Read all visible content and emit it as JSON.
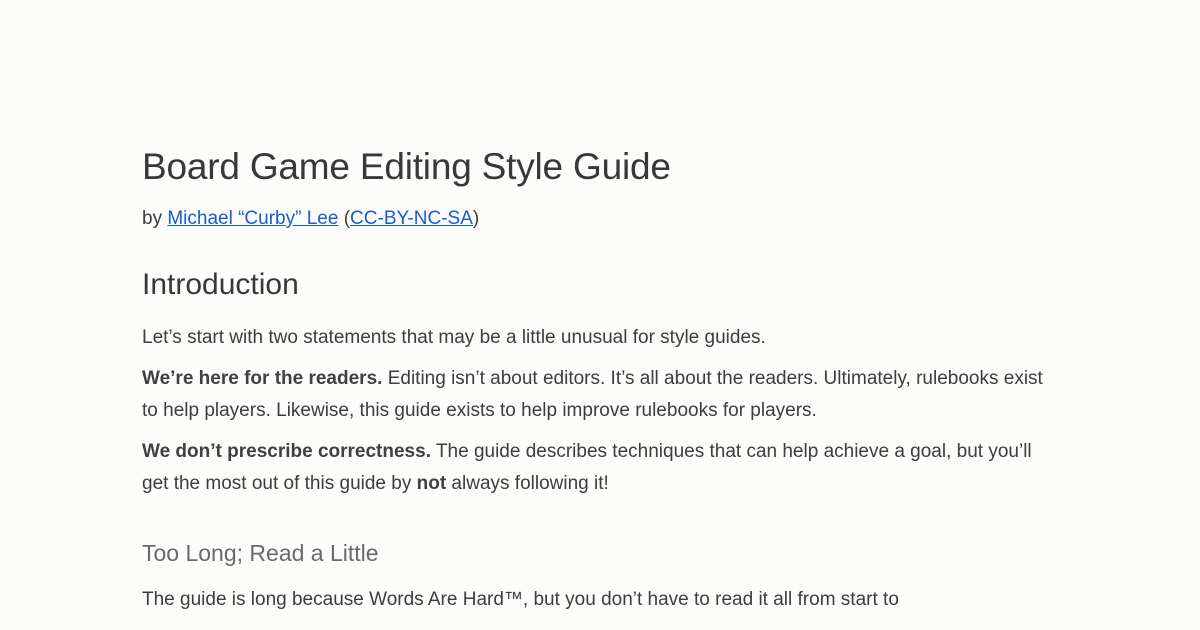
{
  "document": {
    "title": "Board Game Editing Style Guide",
    "byline": {
      "prefix": "by ",
      "author_link": "Michael “Curby” Lee",
      "paren_open": " (",
      "license_link": "CC-BY-NC-SA",
      "paren_close": ")"
    },
    "sections": {
      "introduction": {
        "heading": "Introduction",
        "para1": "Let’s start with two statements that may be a little unusual for style guides.",
        "para2": {
          "bold": "We’re here for the readers.",
          "text": " Editing isn’t about editors. It’s all about the readers. Ultimately, rulebooks exist to help players. Likewise, this guide exists to help improve rulebooks for players."
        },
        "para3": {
          "bold": "We don’t prescribe correctness.",
          "text_before": " The guide describes techniques that can help achieve a goal, but you’ll get the most out of this guide by ",
          "emphasis": "not",
          "text_after": " always following it!"
        }
      },
      "tldr": {
        "heading": "Too Long; Read a Little",
        "para1": "The guide is long because Words Are Hard™, but you don’t have to read it all from start to"
      }
    }
  },
  "colors": {
    "background": "#fcfcfb",
    "text": "#3d3d3d",
    "link": "#1a5cc8",
    "subheading": "#6a6a6a"
  }
}
